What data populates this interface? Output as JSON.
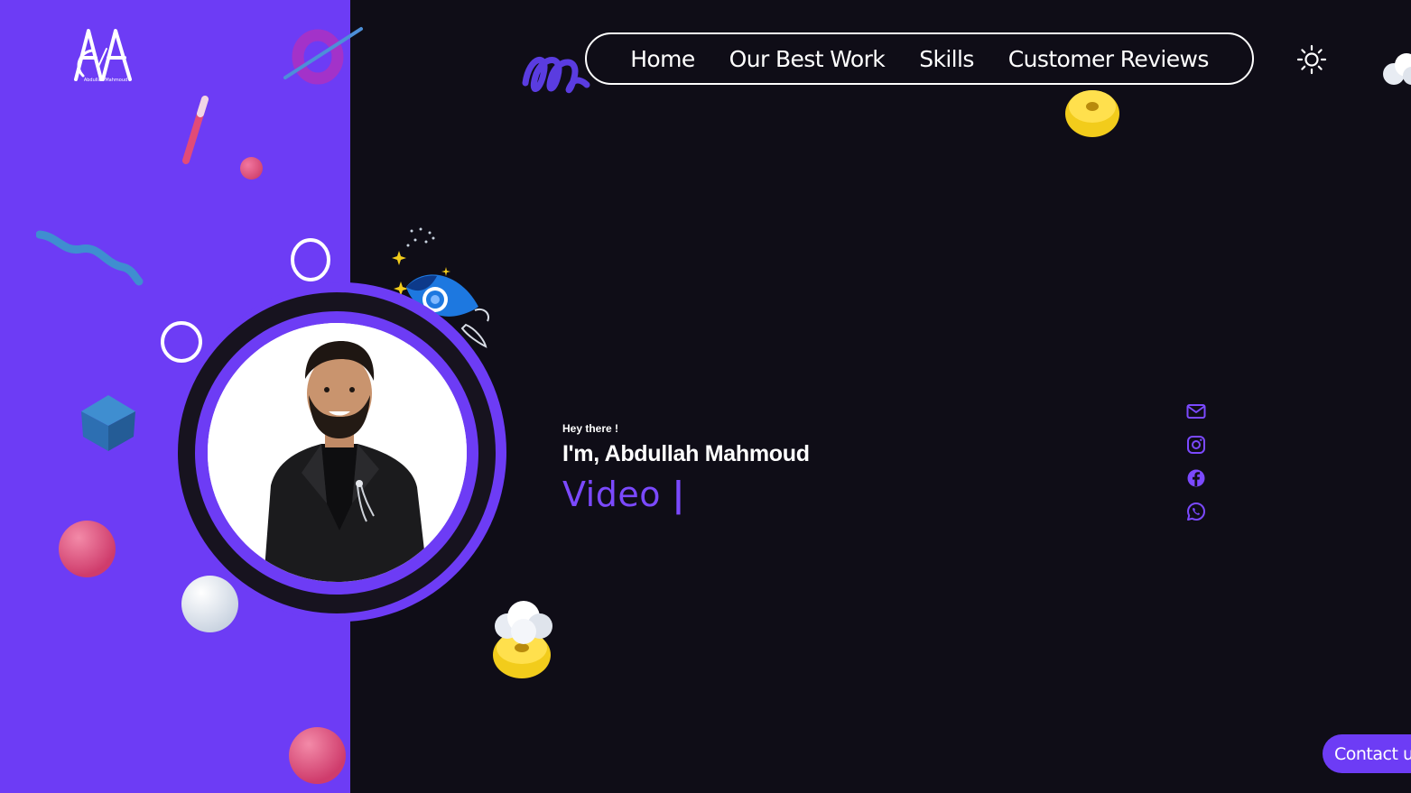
{
  "brand": {
    "logo_icon": "aa-monogram-logo",
    "logo_caption": "Abdullah Mahmoud"
  },
  "nav": {
    "items": [
      {
        "label": "Home"
      },
      {
        "label": "Our Best Work"
      },
      {
        "label": "Skills"
      },
      {
        "label": "Customer Reviews"
      }
    ],
    "theme_toggle_icon": "sun-icon"
  },
  "hero": {
    "greeting": "Hey there !",
    "name": "I'm, Abdullah Mahmoud",
    "typed_role": "Video ",
    "caret": "|",
    "avatar_alt": "Abdullah Mahmoud portrait"
  },
  "socials": [
    {
      "icon": "mail-icon"
    },
    {
      "icon": "instagram-icon"
    },
    {
      "icon": "facebook-icon"
    },
    {
      "icon": "whatsapp-icon"
    }
  ],
  "contact": {
    "label": "Contact us"
  },
  "colors": {
    "accent": "#6d3cf5",
    "background": "#0f0d17",
    "text": "#ffffff",
    "role_text": "#7b49ff"
  }
}
